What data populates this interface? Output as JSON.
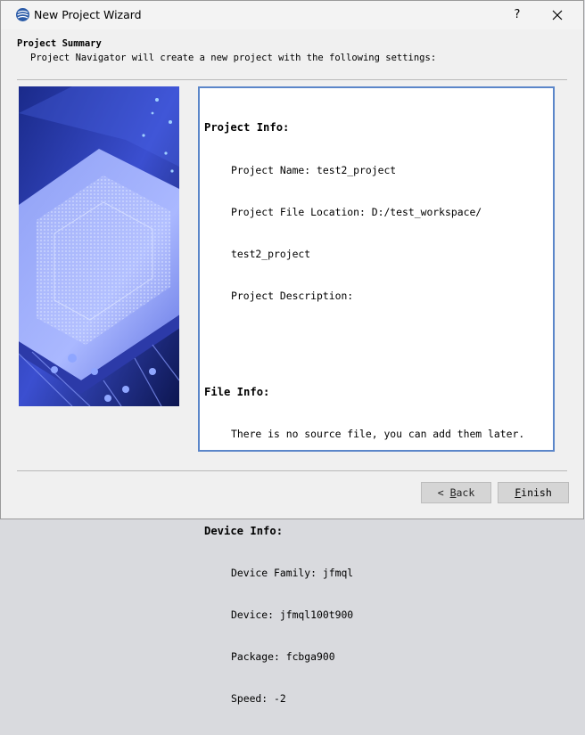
{
  "window": {
    "title": "New Project Wizard",
    "help_label": "?",
    "close_icon": "close-icon"
  },
  "header": {
    "title": "Project Summary",
    "subtitle": "Project Navigator will create a new project with the following settings:"
  },
  "summary": {
    "project_info": {
      "heading": "Project Info:",
      "lines": [
        "Project Name: test2_project",
        "Project File Location: D:/test_workspace/",
        "test2_project",
        "Project Description:"
      ]
    },
    "file_info": {
      "heading": "File Info:",
      "lines": [
        "There is no source file, you can add them later."
      ]
    },
    "device_info": {
      "heading": "Device Info:",
      "lines": [
        "Device Family: jfmql",
        "Device: jfmql100t900",
        "Package: fcbga900",
        "Speed: -2"
      ]
    }
  },
  "buttons": {
    "back_prefix": "< ",
    "back_mnemonic": "B",
    "back_rest": "ack",
    "finish_mnemonic": "F",
    "finish_rest": "inish"
  },
  "colors": {
    "accent": "#5b86c9",
    "background": "#f0f0f0",
    "button": "#d5d5d5"
  }
}
